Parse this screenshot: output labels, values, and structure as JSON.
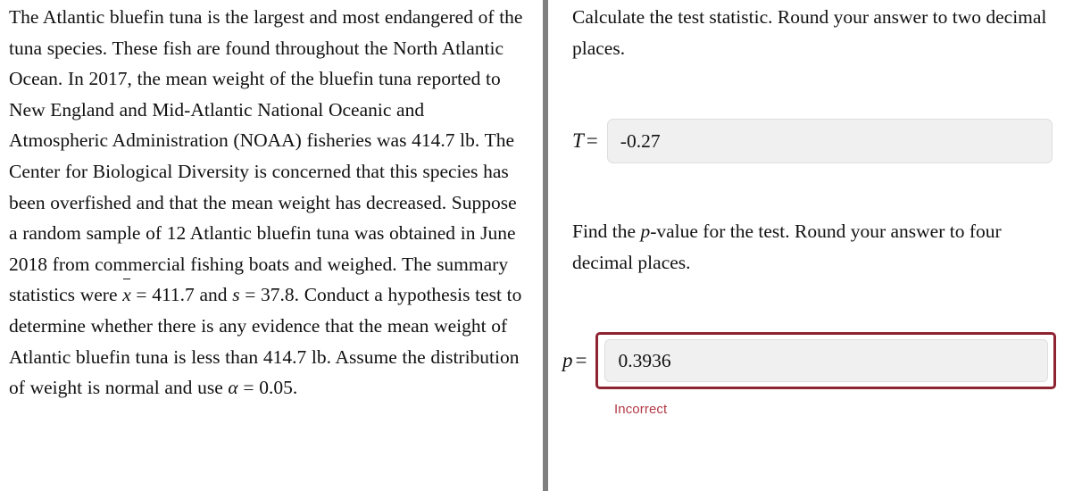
{
  "layout": {
    "divider_color": "#7f7f7f",
    "background": "#ffffff"
  },
  "left_panel": {
    "problem_text": "The Atlantic bluefin tuna is the largest and most endangered of the tuna species. These fish are found throughout the North Atlantic Ocean. In 2017, the mean weight of the bluefin tuna reported to New England and Mid-Atlantic National Oceanic and Atmospheric Administration (NOAA) fisheries was 414.7 lb. The Center for Biological Diversity is concerned that this species has been overfished and that the mean weight has decreased. Suppose a random sample of 12 Atlantic bluefin tuna was obtained in June 2018 from commercial fishing boats and weighed. The summary statistics were",
    "stats_line_prefix": "x",
    "stats_line": " = 411.7 and ",
    "stats_var_s": "s",
    "stats_line_2": " = 37.8. Conduct a hypothesis test to determine whether there is any evidence that the mean weight of Atlantic bluefin tuna is less than 414.7 lb. Assume the distribution of weight is normal and use ",
    "alpha_symbol": "α",
    "alpha_value": " = 0.05.",
    "mean_value": "411.7",
    "sd_value": "37.8",
    "sample_size": "12",
    "population_mean": "414.7 lb",
    "significance_level": "0.05"
  },
  "right_panel": {
    "prompt_test_statistic": "Calculate the test statistic. Round your answer to two decimal places.",
    "prompt_p_value_part1": "Find the ",
    "prompt_p_value_italic": "p",
    "prompt_p_value_part2": "-value for the test. Round your answer to four decimal places.",
    "test_statistic": {
      "label": "T",
      "equals": "=",
      "value": "-0.27",
      "placeholder": "",
      "state": "neutral"
    },
    "p_value": {
      "label": "p",
      "equals": "=",
      "value": "0.3936",
      "placeholder": "",
      "state": "incorrect",
      "feedback": "Incorrect",
      "feedback_color": "#b23a48",
      "border_color": "#8e2331"
    }
  }
}
